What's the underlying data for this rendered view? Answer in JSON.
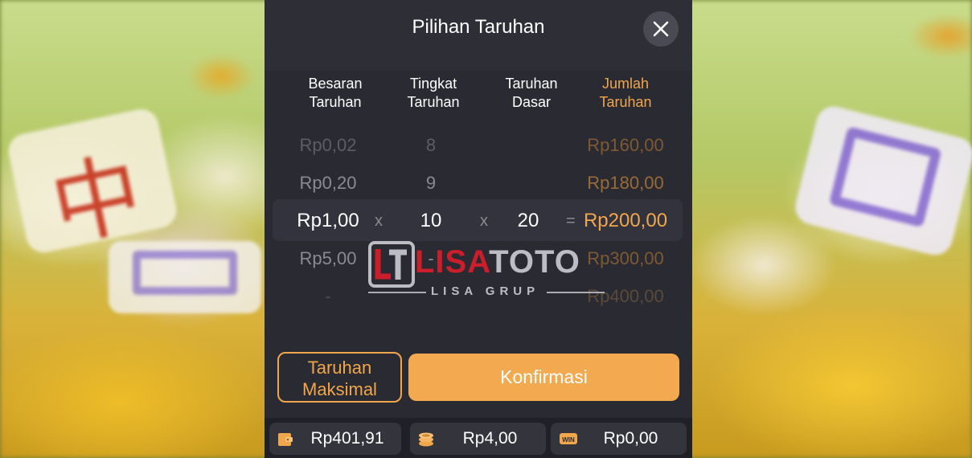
{
  "dialog": {
    "title": "Pilihan Taruhan"
  },
  "columns": {
    "besaran": [
      "Besaran",
      "Taruhan"
    ],
    "tingkat": [
      "Tingkat",
      "Taruhan"
    ],
    "dasar": [
      "Taruhan",
      "Dasar"
    ],
    "jumlah": [
      "Jumlah",
      "Taruhan"
    ]
  },
  "picker": {
    "rows": [
      {
        "besaran": "Rp0,02",
        "tingkat": "8",
        "dasar": "",
        "jumlah": "Rp160,00"
      },
      {
        "besaran": "Rp0,20",
        "tingkat": "9",
        "dasar": "",
        "jumlah": "Rp180,00"
      },
      {
        "besaran": "Rp1,00",
        "tingkat": "10",
        "dasar": "20",
        "jumlah": "Rp200,00"
      },
      {
        "besaran": "Rp5,00",
        "tingkat": "-",
        "dasar": "",
        "jumlah": "Rp300,00"
      },
      {
        "besaran": "-",
        "tingkat": "",
        "dasar": "",
        "jumlah": "Rp400,00"
      }
    ],
    "ops": {
      "times1": "x",
      "times2": "x",
      "equals": "="
    }
  },
  "buttons": {
    "max_line1": "Taruhan",
    "max_line2": "Maksimal",
    "confirm": "Konfirmasi"
  },
  "footer": {
    "balance": "Rp401,91",
    "bet": "Rp4,00",
    "win": "Rp0,00",
    "win_icon_text": "WIN"
  },
  "watermark": {
    "brand_part1": "LISA",
    "brand_part2": "TOTO",
    "tagline": "LISA GRUP"
  },
  "colors": {
    "accent": "#f0a64b",
    "panel": "#2a2a33",
    "confirm": "#f2a950"
  }
}
